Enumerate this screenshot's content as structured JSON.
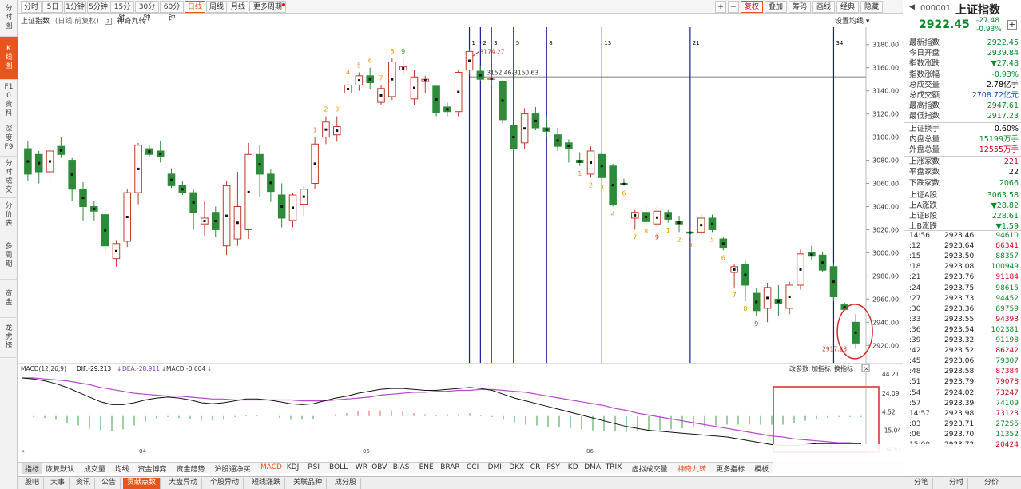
{
  "left_sidebar": [
    {
      "label": "分时图",
      "active": false
    },
    {
      "label": "K线图",
      "active": true
    },
    {
      "label": "F10资料",
      "active": false
    },
    {
      "label": "深度F9",
      "active": false
    },
    {
      "label": "分时成交",
      "active": false
    },
    {
      "label": "分价表",
      "active": false
    },
    {
      "label": "多周期",
      "active": false
    },
    {
      "label": "资金",
      "active": false
    },
    {
      "label": "龙虎榜",
      "active": false
    }
  ],
  "toolbar": {
    "periods": [
      "分时",
      "5日",
      "1分钟",
      "5分钟",
      "15分钟",
      "30分钟",
      "60分钟",
      "日线",
      "周线",
      "月线",
      "更多周期"
    ],
    "active_period": "日线",
    "right_buttons": [
      "+",
      "−",
      "复权",
      "叠加",
      "筹码",
      "画线",
      "经典",
      "隐藏"
    ],
    "active_right": "复权"
  },
  "chart_header": {
    "title": "上证指数",
    "subtitle": "(日线,前复权)",
    "help": "?",
    "indicator": "神奇九转",
    "settings": "设置均线"
  },
  "price_axis": [
    "3180.00",
    "3160.00",
    "3140.00",
    "3120.00",
    "3100.00",
    "3080.00",
    "3060.00",
    "3040.00",
    "3020.00",
    "3000.00",
    "2980.00",
    "2960.00",
    "2940.00",
    "2920.00"
  ],
  "annotations": {
    "high_label": "3174.27",
    "range_label": "3152.46-3150.63",
    "low_label": "2917.23",
    "fib_labels": [
      "1",
      "2",
      "3",
      "5",
      "8",
      "13",
      "21",
      "34"
    ]
  },
  "macd": {
    "label": "MACD(12,26,9)",
    "dif": "DIF:-29.213",
    "dea": "DEA:-28.911",
    "macd": "MACD:-0.604",
    "controls": [
      "改参数",
      "加指标",
      "换指标"
    ],
    "axis": [
      "44.21",
      "24.09",
      "4.52",
      "-15.04",
      "-34.61"
    ],
    "months": [
      "04",
      "05",
      "06"
    ]
  },
  "indicator_tabs": [
    "指标",
    "恢复默认",
    "成交量",
    "均线",
    "资金博弈",
    "资金趋势",
    "沪股通净买",
    "MACD",
    "KDJ",
    "RSI",
    "BOLL",
    "WR",
    "OBV",
    "BIAS",
    "ENE",
    "BRAR",
    "CCI",
    "DMI",
    "DKX",
    "CR",
    "PSY",
    "KD",
    "DMA",
    "TRIX",
    "虚拟成交量",
    "神奇九转",
    "更多指标",
    "模板"
  ],
  "active_indicator": "MACD",
  "highlight_indicator": "神奇九转",
  "bottom_tabs": [
    "股吧",
    "大事",
    "资讯",
    "公告",
    "贡献点数",
    "大盘异动",
    "个股异动",
    "短线涨跌",
    "关联品种",
    "成分股"
  ],
  "active_bottom_tab": "贡献点数",
  "quote": {
    "code": "000001",
    "name": "上证指数",
    "price": "2922.45",
    "change": "-27.48",
    "change_pct": "-0.93%",
    "add_icon": "+"
  },
  "stats": [
    {
      "label": "最新指数",
      "value": "2922.45",
      "color": "green"
    },
    {
      "label": "今日开盘",
      "value": "2939.84",
      "color": "green"
    },
    {
      "label": "指数涨跌",
      "value": "▼27.48",
      "color": "green"
    },
    {
      "label": "指数涨幅",
      "value": "-0.93%",
      "color": "green"
    },
    {
      "label": "总成交量",
      "value": "2.78亿手",
      "color": "black"
    },
    {
      "label": "总成交额",
      "value": "2708.72亿元",
      "color": "blue"
    },
    {
      "label": "最高指数",
      "value": "2947.61",
      "color": "green"
    },
    {
      "label": "最低指数",
      "value": "2917.23",
      "color": "green"
    },
    {
      "label": "上证换手",
      "value": "0.60%",
      "color": "black"
    },
    {
      "label": "内盘总量",
      "value": "15199万手",
      "color": "green"
    },
    {
      "label": "外盘总量",
      "value": "12555万手",
      "color": "red"
    },
    {
      "label": "上涨家数",
      "value": "221",
      "color": "red"
    },
    {
      "label": "平盘家数",
      "value": "22",
      "color": "black"
    },
    {
      "label": "下跌家数",
      "value": "2066",
      "color": "green"
    },
    {
      "label": "上证A股",
      "value": "3063.58",
      "color": "green"
    },
    {
      "label": "上A涨跌",
      "value": "▼28.82",
      "color": "green"
    },
    {
      "label": "上证B股",
      "value": "228.61",
      "color": "green"
    },
    {
      "label": "上B涨跌",
      "value": "▼1.59",
      "color": "green"
    }
  ],
  "ticks": [
    {
      "time": "14:56",
      "price": "2923.46",
      "vol": "94610",
      "color": "green"
    },
    {
      "time": ":12",
      "price": "2923.64",
      "vol": "86341",
      "color": "red"
    },
    {
      "time": ":15",
      "price": "2923.50",
      "vol": "88357",
      "color": "green"
    },
    {
      "time": ":18",
      "price": "2923.08",
      "vol": "100949",
      "color": "green"
    },
    {
      "time": ":21",
      "price": "2923.76",
      "vol": "91184",
      "color": "red"
    },
    {
      "time": ":24",
      "price": "2923.75",
      "vol": "98615",
      "color": "green"
    },
    {
      "time": ":27",
      "price": "2923.73",
      "vol": "94452",
      "color": "green"
    },
    {
      "time": ":30",
      "price": "2923.36",
      "vol": "89759",
      "color": "green"
    },
    {
      "time": ":33",
      "price": "2923.55",
      "vol": "94393",
      "color": "red"
    },
    {
      "time": ":36",
      "price": "2923.54",
      "vol": "102381",
      "color": "green"
    },
    {
      "time": ":39",
      "price": "2923.32",
      "vol": "91198",
      "color": "green"
    },
    {
      "time": ":42",
      "price": "2923.52",
      "vol": "86242",
      "color": "red"
    },
    {
      "time": ":45",
      "price": "2923.06",
      "vol": "79307",
      "color": "green"
    },
    {
      "time": ":48",
      "price": "2923.58",
      "vol": "87384",
      "color": "red"
    },
    {
      "time": ":51",
      "price": "2923.79",
      "vol": "79078",
      "color": "red"
    },
    {
      "time": ":54",
      "price": "2924.02",
      "vol": "73247",
      "color": "red"
    },
    {
      "time": ":57",
      "price": "2923.39",
      "vol": "74109",
      "color": "green"
    },
    {
      "time": "14:57",
      "price": "2923.98",
      "vol": "73123",
      "color": "red"
    },
    {
      "time": ":03",
      "price": "2923.71",
      "vol": "27255",
      "color": "green"
    },
    {
      "time": ":06",
      "price": "2923.70",
      "vol": "11352",
      "color": "green"
    },
    {
      "time": "15:00",
      "price": "2923.72",
      "vol": "20424",
      "color": "red"
    }
  ],
  "right_bottom_tabs": [
    "分笔",
    "分时",
    "分价"
  ],
  "colors": {
    "accent": "#e8541c",
    "up": "#c0392b",
    "down": "#2e8b3a",
    "fib": "#1a1aa0"
  },
  "chart_data": {
    "type": "candlestick",
    "price_range": [
      2905,
      3195
    ],
    "candles": [
      {
        "o": 3090,
        "h": 3097,
        "l": 3062,
        "c": 3068
      },
      {
        "o": 3085,
        "h": 3088,
        "l": 3060,
        "c": 3070
      },
      {
        "o": 3070,
        "h": 3093,
        "l": 3062,
        "c": 3088
      },
      {
        "o": 3092,
        "h": 3100,
        "l": 3082,
        "c": 3085
      },
      {
        "o": 3080,
        "h": 3082,
        "l": 3045,
        "c": 3055
      },
      {
        "o": 3055,
        "h": 3061,
        "l": 3028,
        "c": 3040
      },
      {
        "o": 3040,
        "h": 3045,
        "l": 3028,
        "c": 3036
      },
      {
        "o": 3033,
        "h": 3038,
        "l": 3000,
        "c": 3006
      },
      {
        "o": 2995,
        "h": 3011,
        "l": 2988,
        "c": 3008
      },
      {
        "o": 3010,
        "h": 3055,
        "l": 3005,
        "c": 3052
      },
      {
        "o": 3052,
        "h": 3095,
        "l": 3042,
        "c": 3093
      },
      {
        "o": 3090,
        "h": 3093,
        "l": 3083,
        "c": 3085
      },
      {
        "o": 3088,
        "h": 3097,
        "l": 3078,
        "c": 3083
      },
      {
        "o": 3068,
        "h": 3073,
        "l": 3056,
        "c": 3058
      },
      {
        "o": 3058,
        "h": 3062,
        "l": 3050,
        "c": 3052
      },
      {
        "o": 3052,
        "h": 3055,
        "l": 3020,
        "c": 3035
      },
      {
        "o": 3025,
        "h": 3045,
        "l": 3015,
        "c": 3030
      },
      {
        "o": 3035,
        "h": 3040,
        "l": 3014,
        "c": 3020
      },
      {
        "o": 3006,
        "h": 3062,
        "l": 2998,
        "c": 3058
      },
      {
        "o": 3012,
        "h": 3070,
        "l": 3006,
        "c": 3040
      },
      {
        "o": 3020,
        "h": 3095,
        "l": 3012,
        "c": 3085
      },
      {
        "o": 3085,
        "h": 3093,
        "l": 3048,
        "c": 3068
      },
      {
        "o": 3068,
        "h": 3072,
        "l": 3044,
        "c": 3053
      },
      {
        "o": 3050,
        "h": 3060,
        "l": 3022,
        "c": 3030
      },
      {
        "o": 3028,
        "h": 3052,
        "l": 3022,
        "c": 3050
      },
      {
        "o": 3042,
        "h": 3058,
        "l": 3032,
        "c": 3055
      },
      {
        "o": 3060,
        "h": 3100,
        "l": 3055,
        "c": 3094
      },
      {
        "o": 3100,
        "h": 3118,
        "l": 3094,
        "c": 3113
      },
      {
        "o": 3102,
        "h": 3118,
        "l": 3096,
        "c": 3109
      },
      {
        "o": 3138,
        "h": 3150,
        "l": 3133,
        "c": 3145
      },
      {
        "o": 3145,
        "h": 3156,
        "l": 3140,
        "c": 3153
      },
      {
        "o": 3153,
        "h": 3160,
        "l": 3141,
        "c": 3147
      },
      {
        "o": 3130,
        "h": 3145,
        "l": 3128,
        "c": 3142
      },
      {
        "o": 3135,
        "h": 3168,
        "l": 3132,
        "c": 3165
      },
      {
        "o": 3158,
        "h": 3168,
        "l": 3154,
        "c": 3161
      },
      {
        "o": 3133,
        "h": 3158,
        "l": 3128,
        "c": 3152
      },
      {
        "o": 3148,
        "h": 3153,
        "l": 3138,
        "c": 3150
      },
      {
        "o": 3144,
        "h": 3144,
        "l": 3118,
        "c": 3121
      },
      {
        "o": 3126,
        "h": 3130,
        "l": 3118,
        "c": 3122
      },
      {
        "o": 3122,
        "h": 3158,
        "l": 3118,
        "c": 3156
      },
      {
        "o": 3158,
        "h": 3176,
        "l": 3154,
        "c": 3174
      },
      {
        "o": 3157,
        "h": 3162,
        "l": 3148,
        "c": 3150
      },
      {
        "o": 3150,
        "h": 3156,
        "l": 3145,
        "c": 3151
      },
      {
        "o": 3148,
        "h": 3148,
        "l": 3112,
        "c": 3115
      },
      {
        "o": 3110,
        "h": 3112,
        "l": 3088,
        "c": 3090
      },
      {
        "o": 3095,
        "h": 3125,
        "l": 3090,
        "c": 3120
      },
      {
        "o": 3120,
        "h": 3126,
        "l": 3106,
        "c": 3108
      },
      {
        "o": 3108,
        "h": 3118,
        "l": 3100,
        "c": 3105
      },
      {
        "o": 3102,
        "h": 3108,
        "l": 3088,
        "c": 3092
      },
      {
        "o": 3095,
        "h": 3098,
        "l": 3078,
        "c": 3090
      },
      {
        "o": 3080,
        "h": 3087,
        "l": 3075,
        "c": 3078
      },
      {
        "o": 3068,
        "h": 3092,
        "l": 3065,
        "c": 3088
      },
      {
        "o": 3085,
        "h": 3087,
        "l": 3063,
        "c": 3065
      },
      {
        "o": 3075,
        "h": 3077,
        "l": 3040,
        "c": 3042
      },
      {
        "o": 3060,
        "h": 3064,
        "l": 3058,
        "c": 3059
      },
      {
        "o": 3030,
        "h": 3037,
        "l": 3020,
        "c": 3035
      },
      {
        "o": 3035,
        "h": 3040,
        "l": 3025,
        "c": 3027
      },
      {
        "o": 3025,
        "h": 3040,
        "l": 3020,
        "c": 3036
      },
      {
        "o": 3035,
        "h": 3037,
        "l": 3026,
        "c": 3029
      },
      {
        "o": 3027,
        "h": 3032,
        "l": 3018,
        "c": 3025
      },
      {
        "o": 3018,
        "h": 3020,
        "l": 3013,
        "c": 3017
      },
      {
        "o": 3018,
        "h": 3033,
        "l": 3015,
        "c": 3030
      },
      {
        "o": 3030,
        "h": 3033,
        "l": 3018,
        "c": 3020
      },
      {
        "o": 3012,
        "h": 3014,
        "l": 3002,
        "c": 3004
      },
      {
        "o": 2983,
        "h": 2990,
        "l": 2970,
        "c": 2988
      },
      {
        "o": 2990,
        "h": 2993,
        "l": 2958,
        "c": 2972
      },
      {
        "o": 2965,
        "h": 2970,
        "l": 2945,
        "c": 2950
      },
      {
        "o": 2952,
        "h": 2974,
        "l": 2940,
        "c": 2970
      },
      {
        "o": 2960,
        "h": 2972,
        "l": 2945,
        "c": 2956
      },
      {
        "o": 2952,
        "h": 2975,
        "l": 2947,
        "c": 2972
      },
      {
        "o": 2972,
        "h": 3003,
        "l": 2968,
        "c": 2999
      },
      {
        "o": 3000,
        "h": 3006,
        "l": 2994,
        "c": 2997
      },
      {
        "o": 2998,
        "h": 3001,
        "l": 2983,
        "c": 2985
      },
      {
        "o": 2988,
        "h": 2991,
        "l": 2958,
        "c": 2962
      },
      {
        "o": 2955,
        "h": 2957,
        "l": 2950,
        "c": 2951
      },
      {
        "o": 2940,
        "h": 2947,
        "l": 2917,
        "c": 2922
      }
    ],
    "nine_turn_labels": [
      {
        "i": 26,
        "t": "1",
        "c": "orange",
        "pos": "above"
      },
      {
        "i": 27,
        "t": "2",
        "c": "orange",
        "pos": "above"
      },
      {
        "i": 28,
        "t": "3",
        "c": "orange",
        "pos": "above"
      },
      {
        "i": 29,
        "t": "4",
        "c": "orange",
        "pos": "above"
      },
      {
        "i": 30,
        "t": "5",
        "c": "orange",
        "pos": "above"
      },
      {
        "i": 31,
        "t": "6",
        "c": "orange",
        "pos": "above"
      },
      {
        "i": 32,
        "t": "7",
        "c": "orange",
        "pos": "above"
      },
      {
        "i": 33,
        "t": "8",
        "c": "orange",
        "pos": "above"
      },
      {
        "i": 34,
        "t": "9",
        "c": "green",
        "pos": "above"
      },
      {
        "i": 50,
        "t": "1",
        "c": "orange",
        "pos": "below"
      },
      {
        "i": 51,
        "t": "2",
        "c": "orange",
        "pos": "below"
      },
      {
        "i": 52,
        "t": "3",
        "c": "orange",
        "pos": "below"
      },
      {
        "i": 53,
        "t": "4",
        "c": "orange",
        "pos": "below"
      },
      {
        "i": 54,
        "t": "6",
        "c": "orange",
        "pos": "below"
      },
      {
        "i": 55,
        "t": "7",
        "c": "orange",
        "pos": "below"
      },
      {
        "i": 56,
        "t": "8",
        "c": "orange",
        "pos": "below"
      },
      {
        "i": 57,
        "t": "9",
        "c": "red",
        "pos": "below"
      },
      {
        "i": 58,
        "t": "1",
        "c": "orange",
        "pos": "below"
      },
      {
        "i": 59,
        "t": "2",
        "c": "orange",
        "pos": "below"
      },
      {
        "i": 60,
        "t": "3",
        "c": "orange",
        "pos": "below"
      },
      {
        "i": 62,
        "t": "5",
        "c": "orange",
        "pos": "below"
      },
      {
        "i": 63,
        "t": "6",
        "c": "orange",
        "pos": "below"
      },
      {
        "i": 64,
        "t": "7",
        "c": "orange",
        "pos": "below"
      },
      {
        "i": 65,
        "t": "8",
        "c": "orange",
        "pos": "below"
      },
      {
        "i": 66,
        "t": "9",
        "c": "red",
        "pos": "below"
      }
    ],
    "fib_line_index": [
      40,
      41,
      42,
      44,
      47,
      52,
      60,
      73
    ],
    "hline_price": 3152,
    "macd_dif": [
      40,
      39,
      37,
      34,
      30,
      25,
      20,
      15,
      12,
      12,
      14,
      17,
      19,
      20,
      19,
      17,
      14,
      13,
      14,
      16,
      18,
      18,
      17,
      15,
      13,
      12,
      13,
      16,
      19,
      21,
      24,
      26,
      28,
      29,
      29,
      28,
      27,
      27,
      28,
      29,
      30,
      29,
      27,
      23,
      19,
      16,
      13,
      10,
      7,
      4,
      1,
      -2,
      -5,
      -8,
      -11,
      -13,
      -15,
      -16,
      -17,
      -18,
      -19,
      -20,
      -21,
      -22,
      -24,
      -26,
      -28,
      -30,
      -31,
      -31,
      -30,
      -29,
      -29,
      -29,
      -29,
      -29
    ],
    "macd_dea": [
      40,
      40,
      39,
      38,
      37,
      35,
      33,
      30,
      28,
      26,
      24,
      23,
      22,
      21,
      21,
      20,
      19,
      18,
      18,
      17,
      17,
      17,
      17,
      17,
      17,
      16,
      16,
      16,
      17,
      18,
      19,
      20,
      22,
      23,
      24,
      25,
      25,
      26,
      26,
      27,
      27,
      28,
      28,
      27,
      26,
      25,
      23,
      21,
      19,
      17,
      15,
      13,
      11,
      8,
      6,
      3,
      1,
      -1,
      -3,
      -5,
      -7,
      -9,
      -11,
      -13,
      -15,
      -17,
      -19,
      -21,
      -22,
      -24,
      -25,
      -26,
      -27,
      -28,
      -28,
      -29
    ],
    "macd_hist": [
      0,
      -1,
      -2,
      -4,
      -7,
      -10,
      -13,
      -15,
      -16,
      -14,
      -10,
      -6,
      -3,
      -1,
      -2,
      -3,
      -5,
      -5,
      -4,
      -1,
      1,
      1,
      0,
      -2,
      -4,
      -4,
      -3,
      0,
      2,
      3,
      5,
      6,
      6,
      6,
      5,
      3,
      2,
      1,
      2,
      2,
      3,
      1,
      -1,
      -4,
      -7,
      -9,
      -10,
      -11,
      -12,
      -13,
      -14,
      -15,
      -16,
      -16,
      -17,
      -16,
      -16,
      -15,
      -14,
      -13,
      -12,
      -11,
      -10,
      -9,
      -9,
      -9,
      -9,
      -9,
      -9,
      -7,
      -5,
      -3,
      -2,
      -1,
      -1,
      -1
    ],
    "macd_range": [
      -34.61,
      44.21
    ]
  }
}
